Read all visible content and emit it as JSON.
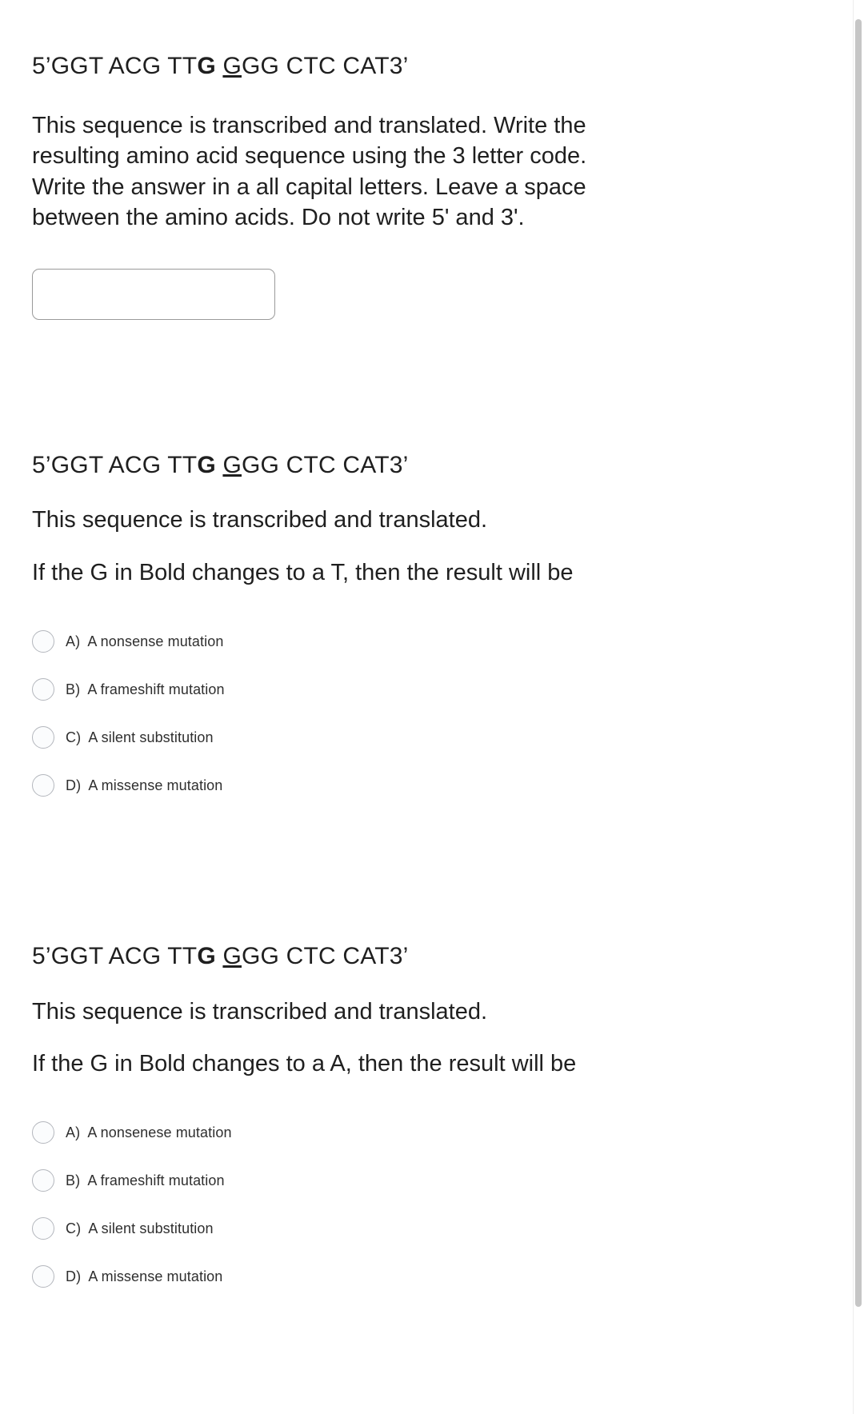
{
  "sequence": {
    "prefix": "5’GGT ACG TT",
    "bold_base": "G",
    "space": " ",
    "underlined_base": "G",
    "suffix": "GG CTC CAT3’",
    "full_text": "5’GGT ACG TTG GGG CTC CAT3’"
  },
  "questions": [
    {
      "id": "q1",
      "type": "short-answer",
      "sequence_prefix": "5’GGT ACG TT",
      "sequence_bold": "G",
      "sequence_underlined": "G",
      "sequence_suffix": "GG CTC CAT3’",
      "prompt": " This sequence is transcribed and translated. Write the resulting amino acid sequence using the 3 letter code. Write the answer in a all capital letters.   Leave a space between the amino acids. Do not write 5' and 3'.",
      "answer_value": "",
      "answer_placeholder": ""
    },
    {
      "id": "q2",
      "type": "multiple-choice",
      "sequence_prefix": "5’GGT ACG TT",
      "sequence_bold": "G",
      "sequence_underlined": "G",
      "sequence_suffix": "GG CTC CAT3’",
      "prompt_line1": " This sequence is transcribed and translated.",
      "prompt_line2": "If the G in Bold changes to a T, then the result will be",
      "options": [
        {
          "letter": "A)",
          "text": "A nonsense mutation",
          "selected": false
        },
        {
          "letter": "B)",
          "text": "A frameshift mutation",
          "selected": false
        },
        {
          "letter": "C)",
          "text": "A silent substitution",
          "selected": false
        },
        {
          "letter": "D)",
          "text": "A missense mutation",
          "selected": false
        }
      ]
    },
    {
      "id": "q3",
      "type": "multiple-choice",
      "sequence_prefix": "5’GGT ACG TT",
      "sequence_bold": "G",
      "sequence_underlined": "G",
      "sequence_suffix": "GG CTC CAT3’",
      "prompt_line1": " This sequence is transcribed and translated.",
      "prompt_line2": "If the G in Bold changes to a A, then the result will be",
      "options": [
        {
          "letter": "A)",
          "text": "A nonsenese mutation",
          "selected": false
        },
        {
          "letter": "B)",
          "text": "A frameshift mutation",
          "selected": false
        },
        {
          "letter": "C)",
          "text": "A silent substitution",
          "selected": false
        },
        {
          "letter": "D)",
          "text": "A missense mutation",
          "selected": false
        }
      ]
    }
  ],
  "colors": {
    "background": "#ffffff",
    "text": "#1f1f1f",
    "option_text": "#2f2f2f",
    "radio_border": "#b4b7bd",
    "input_border": "#9a9a9a",
    "scrollbar_thumb": "#c6c6c6"
  }
}
